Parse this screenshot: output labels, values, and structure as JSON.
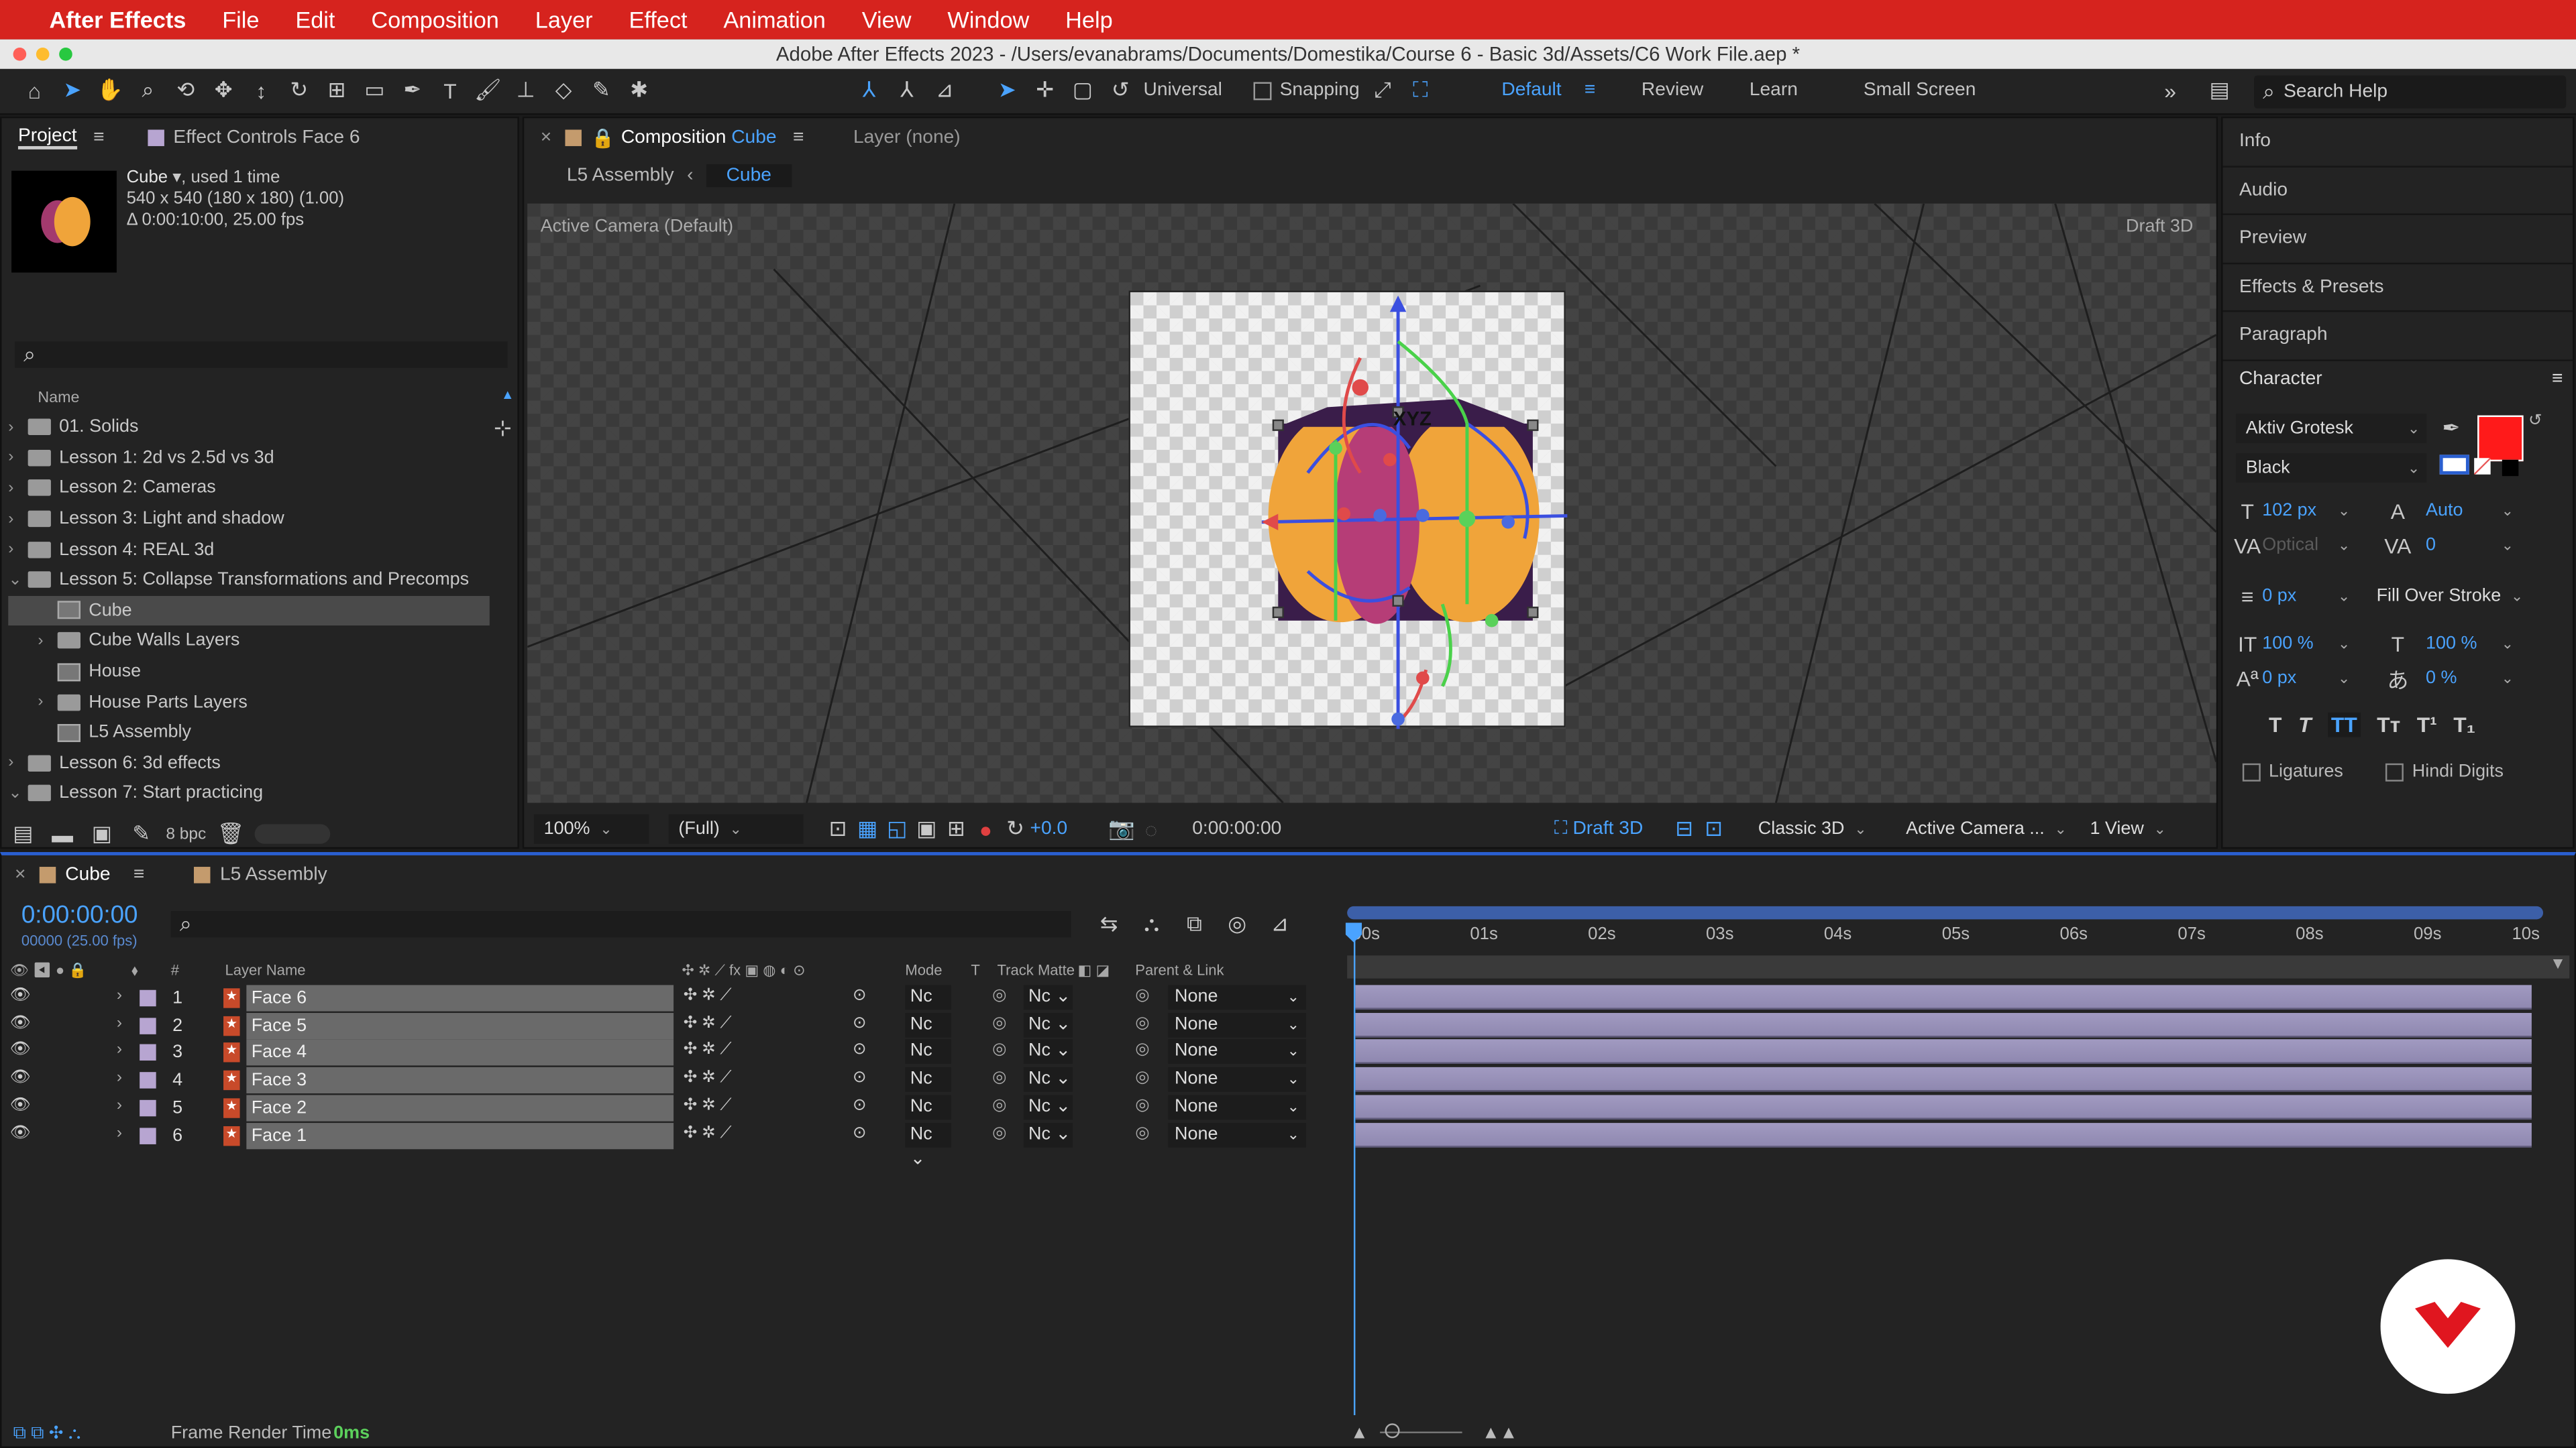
{
  "menubar": {
    "app": "After Effects",
    "items": [
      "File",
      "Edit",
      "Composition",
      "Layer",
      "Effect",
      "Animation",
      "View",
      "Window",
      "Help"
    ]
  },
  "window": {
    "title": "Adobe After Effects 2023 - /Users/evanabrams/Documents/Domestika/Course 6 - Basic 3d/Assets/C6 Work File.aep *"
  },
  "toolbar": {
    "axis_mode": "Universal",
    "snapping": "Snapping",
    "workspaces": [
      "Default",
      "Review",
      "Learn",
      "Small Screen"
    ],
    "active_workspace": "Default",
    "search_placeholder": "Search Help"
  },
  "project": {
    "tab": "Project",
    "effect_tab": "Effect Controls Face 6",
    "selected": {
      "name": "Cube",
      "used": ", used 1 time",
      "size": "540 x 540  (180 x 180) (1.00)",
      "duration": "Δ 0:00:10:00, 25.00 fps"
    },
    "column": "Name",
    "items": [
      {
        "label": "01. Solids",
        "type": "folder",
        "indent": 0,
        "expand": "›"
      },
      {
        "label": "Lesson 1: 2d vs 2.5d vs 3d",
        "type": "folder",
        "indent": 0,
        "expand": "›"
      },
      {
        "label": "Lesson 2: Cameras",
        "type": "folder",
        "indent": 0,
        "expand": "›"
      },
      {
        "label": "Lesson 3: Light and shadow",
        "type": "folder",
        "indent": 0,
        "expand": "›"
      },
      {
        "label": "Lesson 4: REAL 3d",
        "type": "folder",
        "indent": 0,
        "expand": "›"
      },
      {
        "label": "Lesson 5: Collapse Transformations and Precomps",
        "type": "folder",
        "indent": 0,
        "expand": "⌄"
      },
      {
        "label": "Cube",
        "type": "comp",
        "indent": 1,
        "expand": "",
        "selected": true
      },
      {
        "label": "Cube Walls Layers",
        "type": "folder",
        "indent": 1,
        "expand": "›"
      },
      {
        "label": "House",
        "type": "comp",
        "indent": 1,
        "expand": ""
      },
      {
        "label": "House Parts Layers",
        "type": "folder",
        "indent": 1,
        "expand": "›"
      },
      {
        "label": "L5 Assembly",
        "type": "comp",
        "indent": 1,
        "expand": ""
      },
      {
        "label": "Lesson 6: 3d effects",
        "type": "folder",
        "indent": 0,
        "expand": "›"
      },
      {
        "label": "Lesson 7: Start practicing",
        "type": "folder",
        "indent": 0,
        "expand": "⌄"
      }
    ],
    "bpc": "8 bpc"
  },
  "composition": {
    "tab_prefix": "Composition",
    "tab_name": "Cube",
    "layer_tab": "Layer (none)",
    "breadcrumb": [
      "L5 Assembly",
      "Cube"
    ],
    "camera_label": "Active Camera (Default)",
    "renderer_label": "Draft 3D",
    "gizmo_label": "XYZ",
    "zoom": "100%",
    "resolution": "(Full)",
    "exposure": "+0.0",
    "timecode": "0:00:00:00",
    "draft3d": "Draft 3D",
    "renderer": "Classic 3D",
    "view": "Active Camera ...",
    "views": "1 View"
  },
  "right_panel": {
    "items": [
      "Info",
      "Audio",
      "Preview",
      "Effects & Presets",
      "Paragraph"
    ],
    "character": {
      "title": "Character",
      "font": "Aktiv Grotesk",
      "style": "Black",
      "size": "102 px",
      "leading": "Auto",
      "kerning": "Optical",
      "tracking": "0",
      "stroke": "0 px",
      "stroke_type": "Fill Over Stroke",
      "vscale": "100 %",
      "hscale": "100 %",
      "baseline": "0 px",
      "tsume": "0 %",
      "styles": [
        "T",
        "T",
        "TT",
        "Tт",
        "T¹",
        "T₁"
      ],
      "ligatures": "Ligatures",
      "hindi": "Hindi Digits",
      "fill_color": "#ff1a1a"
    }
  },
  "timeline": {
    "tab": "Cube",
    "tab2": "L5 Assembly",
    "time": "0:00:00:00",
    "frame": "00000 (25.00 fps)",
    "headers": {
      "num": "#",
      "name": "Layer Name",
      "mode": "Mode",
      "t": "T",
      "matte": "Track Matte",
      "parent": "Parent & Link"
    },
    "ruler": [
      "00s",
      "01s",
      "02s",
      "03s",
      "04s",
      "05s",
      "06s",
      "07s",
      "08s",
      "09s",
      "10s"
    ],
    "layers": [
      {
        "num": "1",
        "name": "Face 6",
        "mode": "Nc",
        "matte": "Nc",
        "parent": "None"
      },
      {
        "num": "2",
        "name": "Face 5",
        "mode": "Nc",
        "matte": "Nc",
        "parent": "None"
      },
      {
        "num": "3",
        "name": "Face 4",
        "mode": "Nc",
        "matte": "Nc",
        "parent": "None"
      },
      {
        "num": "4",
        "name": "Face 3",
        "mode": "Nc",
        "matte": "Nc",
        "parent": "None"
      },
      {
        "num": "5",
        "name": "Face 2",
        "mode": "Nc",
        "matte": "Nc",
        "parent": "None"
      },
      {
        "num": "6",
        "name": "Face 1",
        "mode": "Nc",
        "matte": "Nc",
        "parent": "None"
      }
    ],
    "footer": {
      "label": "Frame Render Time",
      "value": "0ms"
    }
  }
}
